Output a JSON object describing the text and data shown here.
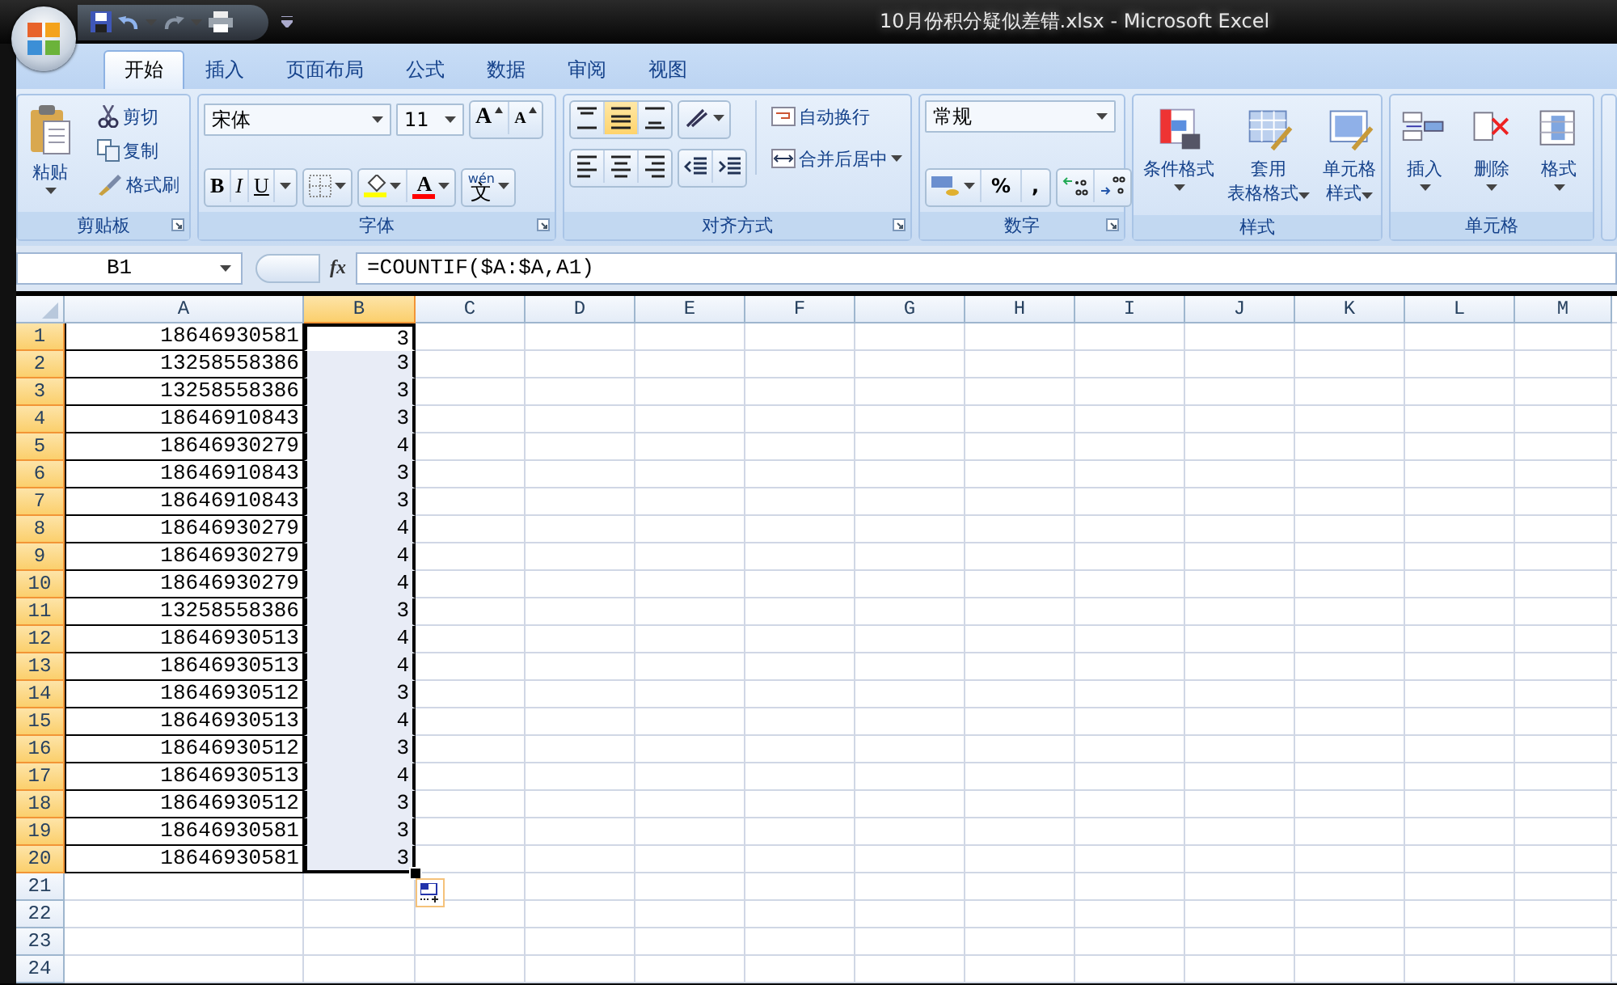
{
  "window": {
    "title": "10月份积分疑似差错.xlsx - Microsoft Excel"
  },
  "ribbon_tabs": [
    {
      "label": "开始",
      "selected": true
    },
    {
      "label": "插入",
      "selected": false
    },
    {
      "label": "页面布局",
      "selected": false
    },
    {
      "label": "公式",
      "selected": false
    },
    {
      "label": "数据",
      "selected": false
    },
    {
      "label": "审阅",
      "selected": false
    },
    {
      "label": "视图",
      "selected": false
    }
  ],
  "ribbon_groups": [
    {
      "kind": "clipboard",
      "label": "剪贴板",
      "paste": "粘贴",
      "commands": [
        "剪切",
        "复制",
        "格式刷"
      ]
    },
    {
      "kind": "font",
      "label": "字体",
      "font_name": "宋体",
      "font_size": "11",
      "size_buttons": [
        "A",
        "A"
      ],
      "style_buttons": [
        {
          "label": "B",
          "kind": "bold"
        },
        {
          "label": "I",
          "kind": "italic"
        },
        {
          "label": "U",
          "kind": "underline"
        }
      ],
      "font_color": {
        "label": "A",
        "color": "#ff0000"
      },
      "phonetic": {
        "ruby": "wén",
        "label": "文"
      }
    },
    {
      "kind": "alignment",
      "label": "对齐方式",
      "vertical_align": [
        {
          "kind": "top",
          "selected": false
        },
        {
          "kind": "middle",
          "selected": true
        },
        {
          "kind": "bottom",
          "selected": false
        }
      ],
      "horizontal_align": [
        {
          "kind": "left",
          "selected": false
        },
        {
          "kind": "center",
          "selected": false
        },
        {
          "kind": "right",
          "selected": false
        }
      ],
      "wrap_text": "自动换行",
      "merge_center": "合并后居中"
    },
    {
      "kind": "number",
      "label": "数字",
      "format": "常规",
      "buttons": [
        "%",
        ","
      ]
    },
    {
      "kind": "styles",
      "label": "样式",
      "commands": [
        {
          "lines": [
            "条件格式"
          ]
        },
        {
          "lines": [
            "套用",
            "表格格式"
          ]
        },
        {
          "lines": [
            "单元格",
            "样式"
          ]
        }
      ]
    },
    {
      "kind": "cells",
      "label": "单元格",
      "commands": [
        {
          "lines": [
            "插入"
          ]
        },
        {
          "lines": [
            "删除"
          ]
        },
        {
          "lines": [
            "格式"
          ]
        }
      ]
    }
  ],
  "formula_bar": {
    "name_box": "B1",
    "fx": "fx",
    "formula": "=COUNTIF($A:$A,A1)"
  },
  "columns": [
    {
      "label": "A",
      "selected": false
    },
    {
      "label": "B",
      "selected": true
    },
    {
      "label": "C",
      "selected": false
    },
    {
      "label": "D",
      "selected": false
    },
    {
      "label": "E",
      "selected": false
    },
    {
      "label": "F",
      "selected": false
    },
    {
      "label": "G",
      "selected": false
    },
    {
      "label": "H",
      "selected": false
    },
    {
      "label": "I",
      "selected": false
    },
    {
      "label": "J",
      "selected": false
    },
    {
      "label": "K",
      "selected": false
    },
    {
      "label": "L",
      "selected": false
    },
    {
      "label": "M",
      "selected": false
    }
  ],
  "rows": [
    {
      "number": "1",
      "a": "18646930581",
      "b": "3",
      "selected": true,
      "active": true
    },
    {
      "number": "2",
      "a": "13258558386",
      "b": "3",
      "selected": true,
      "active": false
    },
    {
      "number": "3",
      "a": "13258558386",
      "b": "3",
      "selected": true,
      "active": false
    },
    {
      "number": "4",
      "a": "18646910843",
      "b": "3",
      "selected": true,
      "active": false
    },
    {
      "number": "5",
      "a": "18646930279",
      "b": "4",
      "selected": true,
      "active": false
    },
    {
      "number": "6",
      "a": "18646910843",
      "b": "3",
      "selected": true,
      "active": false
    },
    {
      "number": "7",
      "a": "18646910843",
      "b": "3",
      "selected": true,
      "active": false
    },
    {
      "number": "8",
      "a": "18646930279",
      "b": "4",
      "selected": true,
      "active": false
    },
    {
      "number": "9",
      "a": "18646930279",
      "b": "4",
      "selected": true,
      "active": false
    },
    {
      "number": "10",
      "a": "18646930279",
      "b": "4",
      "selected": true,
      "active": false
    },
    {
      "number": "11",
      "a": "13258558386",
      "b": "3",
      "selected": true,
      "active": false
    },
    {
      "number": "12",
      "a": "18646930513",
      "b": "4",
      "selected": true,
      "active": false
    },
    {
      "number": "13",
      "a": "18646930513",
      "b": "4",
      "selected": true,
      "active": false
    },
    {
      "number": "14",
      "a": "18646930512",
      "b": "3",
      "selected": true,
      "active": false
    },
    {
      "number": "15",
      "a": "18646930513",
      "b": "4",
      "selected": true,
      "active": false
    },
    {
      "number": "16",
      "a": "18646930512",
      "b": "3",
      "selected": true,
      "active": false
    },
    {
      "number": "17",
      "a": "18646930513",
      "b": "4",
      "selected": true,
      "active": false
    },
    {
      "number": "18",
      "a": "18646930512",
      "b": "3",
      "selected": true,
      "active": false
    },
    {
      "number": "19",
      "a": "18646930581",
      "b": "3",
      "selected": true,
      "active": false
    },
    {
      "number": "20",
      "a": "18646930581",
      "b": "3",
      "selected": true,
      "active": false
    },
    {
      "number": "21",
      "selected": false
    },
    {
      "number": "22",
      "selected": false
    },
    {
      "number": "23",
      "selected": false
    },
    {
      "number": "24",
      "selected": false
    }
  ]
}
